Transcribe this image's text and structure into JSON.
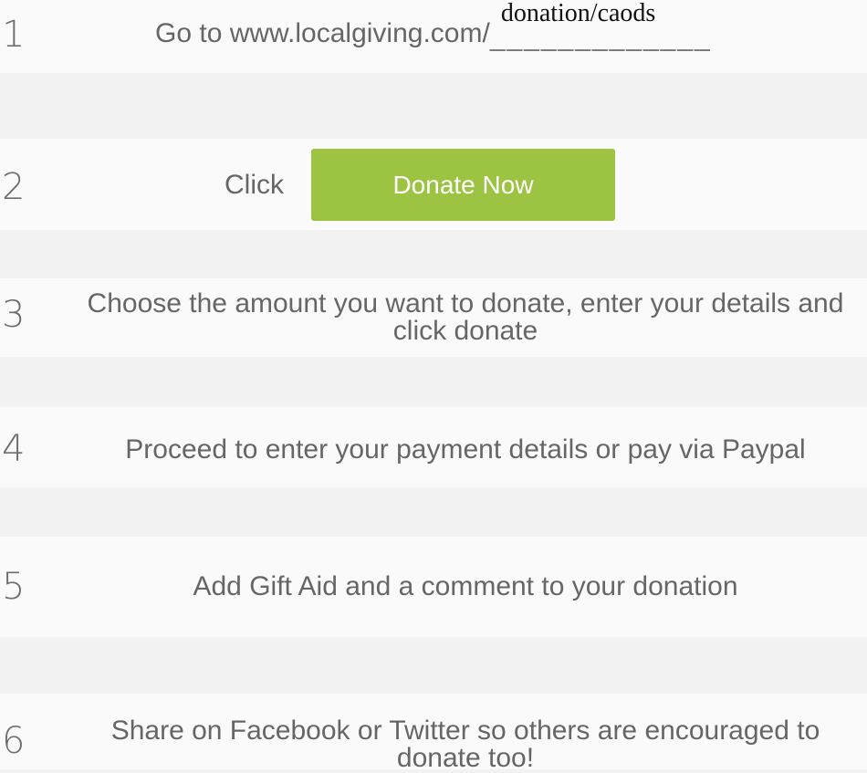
{
  "steps": [
    {
      "number": "1",
      "text_prefix": "Go to www.localgiving.com/",
      "blank_dashes": "_____________",
      "handwritten": "donation/caods"
    },
    {
      "number": "2",
      "click_label": "Click",
      "button_label": "Donate Now"
    },
    {
      "number": "3",
      "line1": "Choose the amount you want to donate, enter your details and",
      "line2": "click donate"
    },
    {
      "number": "4",
      "text": "Proceed to enter your payment details or pay via Paypal"
    },
    {
      "number": "5",
      "text": "Add Gift Aid and a comment to your donation"
    },
    {
      "number": "6",
      "line1": "Share on Facebook or Twitter so others are encouraged to",
      "line2": "donate too!"
    }
  ],
  "colors": {
    "button_green": "#9cc342",
    "text_grey": "#666666",
    "band_light": "#fafafa",
    "band_dark": "#f2f2f2"
  }
}
